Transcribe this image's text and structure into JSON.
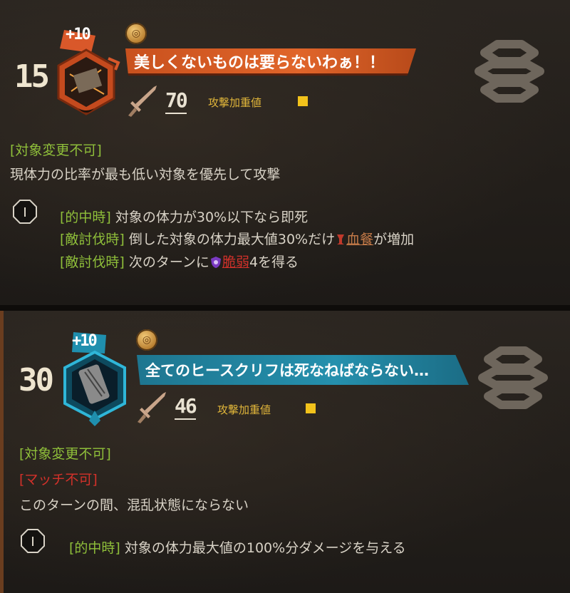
{
  "skills": [
    {
      "level": "15",
      "plus": "+10",
      "name": "美しくないものは要らないわぁ！！",
      "power": "70",
      "weight_label": "攻撃加重値",
      "tags": [
        "[対象変更不可]"
      ],
      "description": "現体力の比率が最も低い対象を優先して攻撃",
      "coin_numeral": "Ⅰ",
      "effects": [
        {
          "trigger": "[的中時]",
          "text": "対象の体力が30%以下なら即死"
        },
        {
          "trigger": "[敵討伐時]",
          "text_pre": "倒した対象の体力最大値30%だけ",
          "status": "血餐",
          "text_post": "が増加"
        },
        {
          "trigger": "[敵討伐時]",
          "text_pre": "次のターンに",
          "status": "脆弱",
          "text_post": "4を得る"
        }
      ],
      "accent": "#d9582a",
      "icons": {
        "badge": "skill-badge-orange",
        "coin": "coin-icon",
        "sword": "sword-icon",
        "emblem": "stack-emblem-icon",
        "bleed": "blood-feast-icon",
        "fragile": "fragile-shield-icon"
      }
    },
    {
      "level": "30",
      "plus": "+10",
      "name": "全てのヒースクリフは死なねばならない…",
      "power": "46",
      "weight_label": "攻撃加重値",
      "tags": [
        "[対象変更不可]",
        "[マッチ不可]"
      ],
      "description": "このターンの間、混乱状態にならない",
      "coin_numeral": "Ⅰ",
      "effects": [
        {
          "trigger": "[的中時]",
          "text": "対象の体力最大値の100%分ダメージを与える"
        }
      ],
      "accent": "#2590ad",
      "icons": {
        "badge": "skill-badge-teal",
        "coin": "coin-icon",
        "sword": "sword-icon",
        "emblem": "stack-emblem-icon"
      }
    }
  ],
  "colors": {
    "condition_green": "#8fbf3a",
    "warning_red": "#d2312a",
    "weight_yellow": "#f2c21b"
  }
}
